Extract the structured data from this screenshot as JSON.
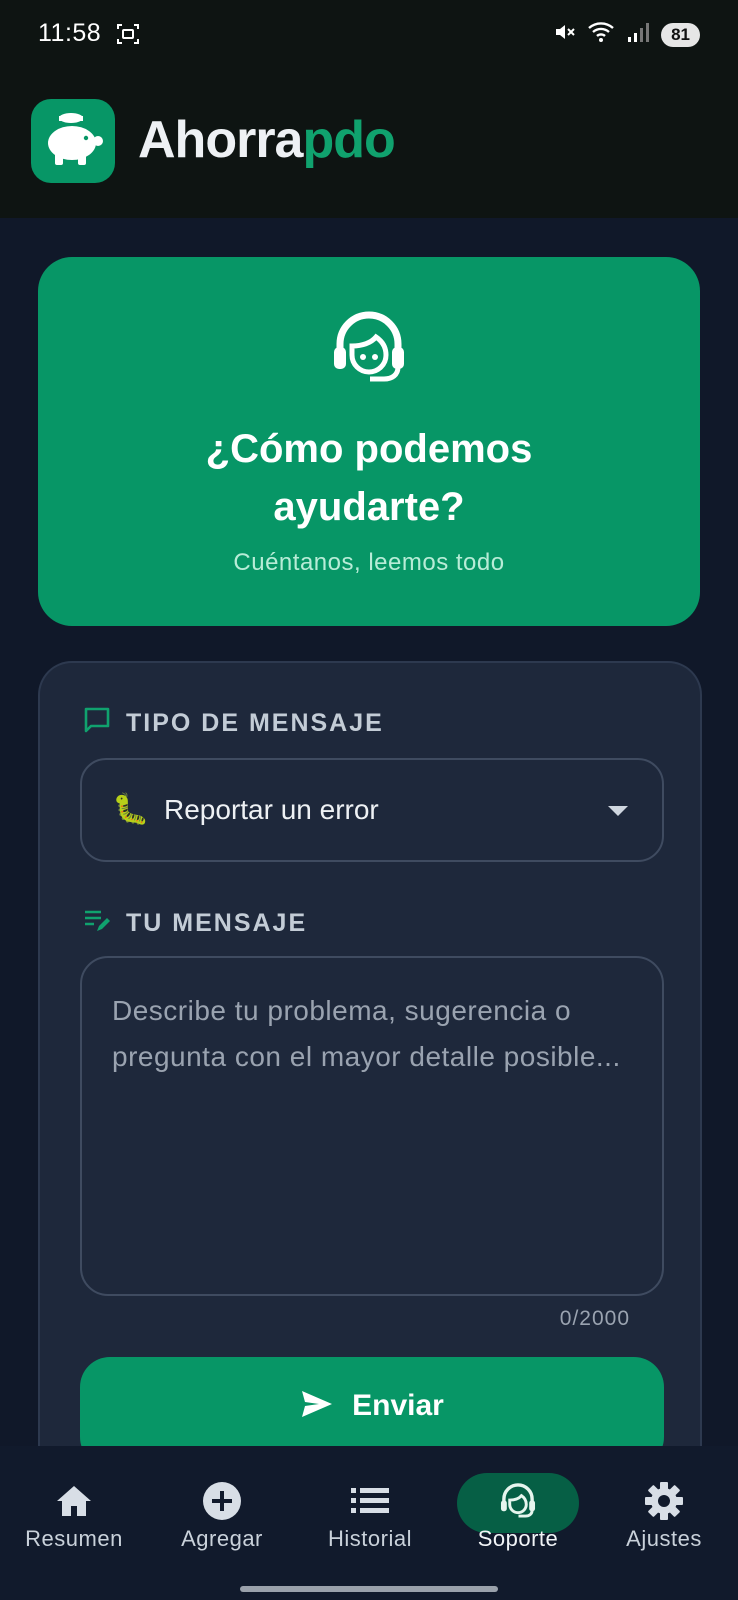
{
  "status_bar": {
    "time": "11:58",
    "battery": "81"
  },
  "app": {
    "title_part1": "Ahorra",
    "title_part2": "pdo"
  },
  "hero": {
    "title_line1": "¿Cómo podemos",
    "title_line2": "ayudarte?",
    "subtitle": "Cuéntanos, leemos todo"
  },
  "form": {
    "type_label": "TIPO DE MENSAJE",
    "type_selected_emoji": "🐛",
    "type_selected": "Reportar un error",
    "message_label": "TU MENSAJE",
    "message_value": "",
    "message_placeholder": "Describe tu problema, sugerencia o pregunta con el mayor detalle posible...",
    "char_count": "0/2000",
    "send_label": "Enviar"
  },
  "nav": {
    "items": [
      {
        "label": "Resumen",
        "icon": "home-icon"
      },
      {
        "label": "Agregar",
        "icon": "add-circle-icon"
      },
      {
        "label": "Historial",
        "icon": "list-icon"
      },
      {
        "label": "Soporte",
        "icon": "support-agent-icon",
        "active": true
      },
      {
        "label": "Ajustes",
        "icon": "settings-icon"
      }
    ]
  },
  "colors": {
    "accent": "#079666",
    "background": "#101829",
    "card": "#1e283b",
    "header": "#0e1412"
  }
}
